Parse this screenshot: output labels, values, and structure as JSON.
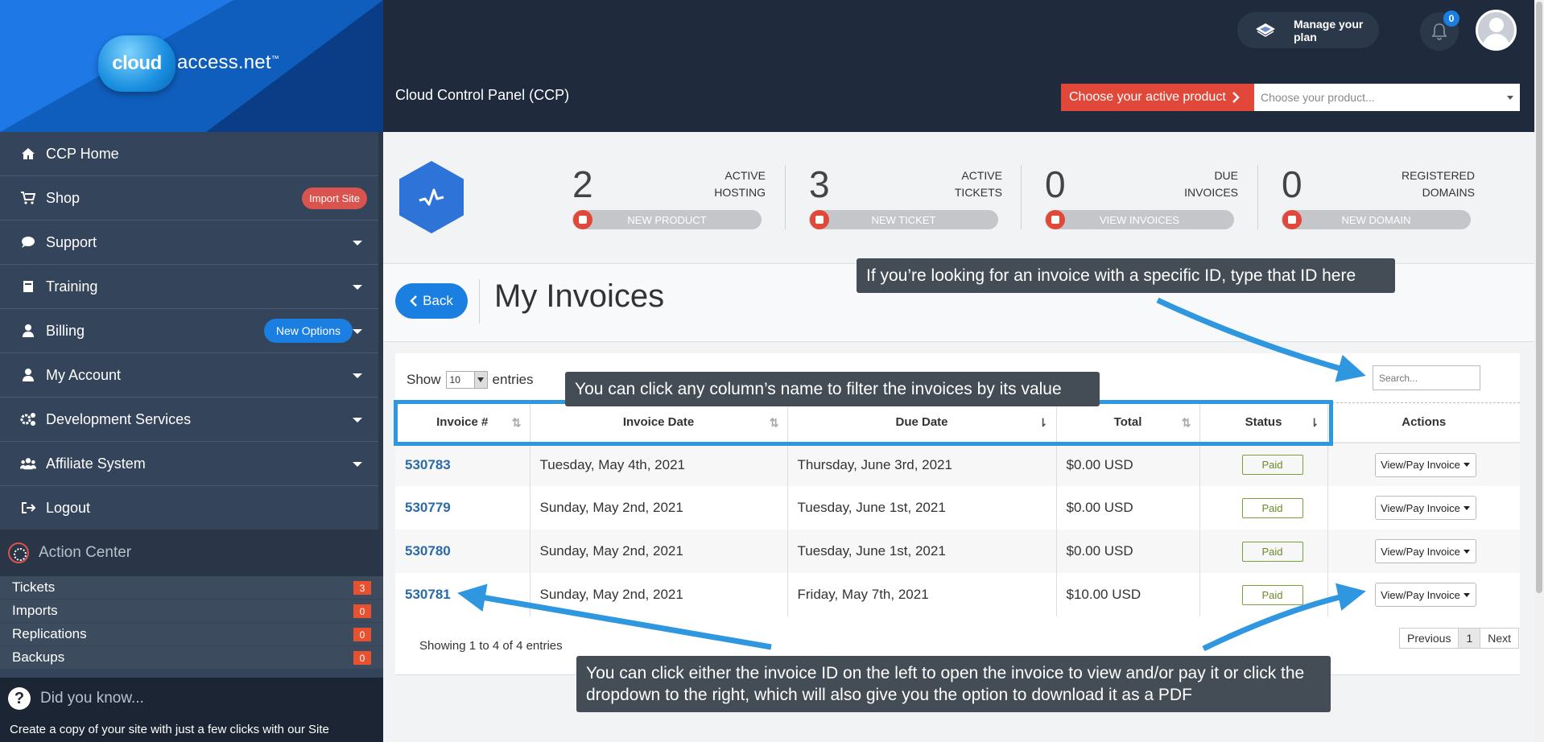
{
  "brand": {
    "logo_cloud": "cloud",
    "logo_text": "access.net",
    "logo_tm": "™"
  },
  "sidebar": {
    "items": [
      {
        "label": "CCP Home",
        "icon": "home-icon"
      },
      {
        "label": "Shop",
        "icon": "cart-icon",
        "badge": "Import Site"
      },
      {
        "label": "Support",
        "icon": "chat-icon"
      },
      {
        "label": "Training",
        "icon": "book-icon"
      },
      {
        "label": "Billing",
        "icon": "user-icon",
        "badge": "New Options"
      },
      {
        "label": "My Account",
        "icon": "user-icon"
      },
      {
        "label": "Development Services",
        "icon": "gears-icon"
      },
      {
        "label": "Affiliate System",
        "icon": "users-icon"
      },
      {
        "label": "Logout",
        "icon": "logout-icon"
      }
    ]
  },
  "action_center": {
    "title": "Action Center",
    "rows": [
      {
        "label": "Tickets",
        "count": "3"
      },
      {
        "label": "Imports",
        "count": "0"
      },
      {
        "label": "Replications",
        "count": "0"
      },
      {
        "label": "Backups",
        "count": "0"
      }
    ]
  },
  "did_you_know": {
    "title": "Did you know...",
    "text": "Create a copy of your site with just a few clicks with our Site"
  },
  "header": {
    "manage_plan": "Manage your plan",
    "notifications": "0",
    "panel_title": "Cloud Control Panel (CCP)",
    "choose_product_btn": "Choose your active product",
    "choose_product_placeholder": "Choose your product..."
  },
  "stats": [
    {
      "number": "2",
      "label_1": "ACTIVE",
      "label_2": "HOSTING",
      "action": "NEW PRODUCT"
    },
    {
      "number": "3",
      "label_1": "ACTIVE",
      "label_2": "TICKETS",
      "action": "NEW TICKET"
    },
    {
      "number": "0",
      "label_1": "DUE",
      "label_2": "INVOICES",
      "action": "VIEW INVOICES"
    },
    {
      "number": "0",
      "label_1": "REGISTERED",
      "label_2": "DOMAINS",
      "action": "NEW DOMAIN"
    }
  ],
  "page": {
    "back": "Back",
    "title": "My Invoices"
  },
  "table": {
    "show_label": "Show",
    "show_value": "10",
    "entries_label": "entries",
    "search_placeholder": "Search...",
    "columns": [
      "Invoice #",
      "Invoice Date",
      "Due Date",
      "Total",
      "Status",
      "Actions"
    ],
    "rows": [
      {
        "id": "530783",
        "invoice_date": "Tuesday, May 4th, 2021",
        "due_date": "Thursday, June 3rd, 2021",
        "total": "$0.00 USD",
        "status": "Paid",
        "action": "View/Pay Invoice"
      },
      {
        "id": "530779",
        "invoice_date": "Sunday, May 2nd, 2021",
        "due_date": "Tuesday, June 1st, 2021",
        "total": "$0.00 USD",
        "status": "Paid",
        "action": "View/Pay Invoice"
      },
      {
        "id": "530780",
        "invoice_date": "Sunday, May 2nd, 2021",
        "due_date": "Tuesday, June 1st, 2021",
        "total": "$0.00 USD",
        "status": "Paid",
        "action": "View/Pay Invoice"
      },
      {
        "id": "530781",
        "invoice_date": "Sunday, May 2nd, 2021",
        "due_date": "Friday, May 7th, 2021",
        "total": "$10.00 USD",
        "status": "Paid",
        "action": "View/Pay Invoice"
      }
    ],
    "showing": "Showing 1 to 4 of 4 entries",
    "pager": {
      "previous": "Previous",
      "current": "1",
      "next": "Next"
    }
  },
  "annotations": {
    "search_tip": "If you’re looking for an invoice with a specific ID, type that ID here",
    "column_tip": "You can click any column’s name to filter the invoices by its value",
    "action_tip": "You can click either the invoice ID on the left to open the invoice to view and/or pay it or click the dropdown to the right, which will also give you the option to download it as a PDF"
  },
  "colors": {
    "accent": "#1a7fe0",
    "sidebar": "#34445a",
    "header": "#1f2b3c",
    "danger": "#e2483a",
    "annotation_arrow": "#2f96e0"
  }
}
